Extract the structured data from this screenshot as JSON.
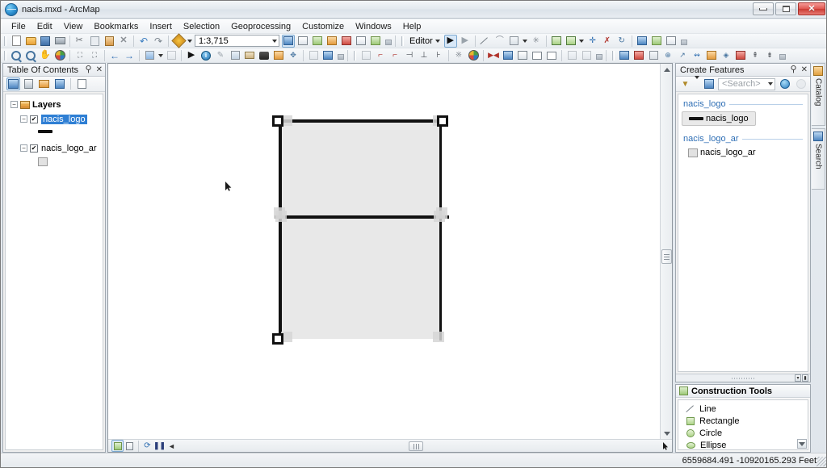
{
  "window": {
    "title": "nacis.mxd - ArcMap",
    "app_icon": "globe-icon",
    "minimize_label": "Minimize",
    "maximize_label": "Maximize",
    "close_label": "✕"
  },
  "menubar": {
    "items": [
      {
        "label": "File"
      },
      {
        "label": "Edit"
      },
      {
        "label": "View"
      },
      {
        "label": "Bookmarks"
      },
      {
        "label": "Insert"
      },
      {
        "label": "Selection"
      },
      {
        "label": "Geoprocessing"
      },
      {
        "label": "Customize"
      },
      {
        "label": "Windows"
      },
      {
        "label": "Help"
      }
    ]
  },
  "standard_toolbar": {
    "scale_value": "1:3,715",
    "scale_dropdown_icon": "chevron-down-icon",
    "buttons": [
      {
        "name": "new-map-document-icon"
      },
      {
        "name": "open-document-icon"
      },
      {
        "name": "save-document-icon"
      },
      {
        "name": "print-icon"
      },
      {
        "name": "cut-icon"
      },
      {
        "name": "copy-icon"
      },
      {
        "name": "paste-icon"
      },
      {
        "name": "delete-icon"
      },
      {
        "name": "undo-icon"
      },
      {
        "name": "redo-icon"
      },
      {
        "name": "add-data-icon"
      }
    ],
    "right_buttons": [
      {
        "name": "editor-toolbar-icon"
      },
      {
        "name": "table-of-contents-icon"
      },
      {
        "name": "catalog-window-icon"
      },
      {
        "name": "search-window-icon"
      },
      {
        "name": "arctoolbox-icon"
      },
      {
        "name": "python-window-icon"
      },
      {
        "name": "model-builder-icon"
      }
    ],
    "editor_label": "Editor"
  },
  "tools_toolbar": {
    "buttons": [
      {
        "name": "zoom-in-icon"
      },
      {
        "name": "zoom-out-icon"
      },
      {
        "name": "pan-icon"
      },
      {
        "name": "full-extent-icon"
      },
      {
        "name": "fixed-zoom-in-icon"
      },
      {
        "name": "fixed-zoom-out-icon"
      },
      {
        "name": "go-back-extent-icon"
      },
      {
        "name": "go-forward-extent-icon"
      },
      {
        "name": "select-features-icon"
      },
      {
        "name": "clear-selection-icon"
      },
      {
        "name": "select-elements-icon"
      },
      {
        "name": "identify-icon"
      },
      {
        "name": "hyperlink-icon"
      },
      {
        "name": "html-popup-icon"
      },
      {
        "name": "measure-icon"
      },
      {
        "name": "find-icon"
      },
      {
        "name": "find-route-icon"
      },
      {
        "name": "go-to-xy-icon"
      },
      {
        "name": "time-slider-icon"
      },
      {
        "name": "create-viewer-window-icon"
      }
    ]
  },
  "table_of_contents": {
    "title": "Table Of Contents",
    "pin_icon": "pin-icon",
    "close_icon": "close-icon",
    "toolbar_buttons": [
      {
        "name": "list-by-drawing-order-icon",
        "selected": true
      },
      {
        "name": "list-by-source-icon",
        "selected": false
      },
      {
        "name": "list-by-visibility-icon",
        "selected": false
      },
      {
        "name": "list-by-selection-icon",
        "selected": false
      },
      {
        "name": "options-icon",
        "selected": false
      }
    ],
    "tree": {
      "root_label": "Layers",
      "root_expander": "−",
      "layers": [
        {
          "label": "nacis_logo",
          "checked": true,
          "check_glyph": "✔",
          "expander": "−",
          "selected": true,
          "symbol": "line-symbol"
        },
        {
          "label": "nacis_logo_ar",
          "checked": true,
          "check_glyph": "✔",
          "expander": "−",
          "selected": false,
          "symbol": "polygon-symbol"
        }
      ]
    }
  },
  "map_view": {
    "data_view_tab_icon": "data-view-icon",
    "layout_view_tab_icon": "layout-view-icon",
    "refresh_icon": "refresh-icon",
    "pause_icon": "pause-drawing-icon",
    "flow_icon": "data-driven-pages-icon",
    "scroll_up_icon": "scroll-up-icon",
    "scroll_down_icon": "scroll-down-icon",
    "cursor": "arrow-cursor",
    "graphic": {
      "description": "selected rectangle feature with edit handles",
      "fill_color": "#e8e8e8",
      "line_color": "#111111",
      "handle_color": "#d6d6d6"
    }
  },
  "create_features": {
    "title": "Create Features",
    "pin_icon": "pin-icon",
    "close_icon": "close-icon",
    "filter_icon": "filter-icon",
    "organize_icon": "organize-templates-icon",
    "search_placeholder": "<Search>",
    "search_value": "",
    "search_dropdown_icon": "chevron-down-icon",
    "search_go_icon": "search-icon",
    "search_clear_icon": "clear-search-icon",
    "groups": [
      {
        "label": "nacis_logo",
        "templates": [
          {
            "label": "nacis_logo",
            "symbol": "line-symbol",
            "selected": true
          }
        ]
      },
      {
        "label": "nacis_logo_ar",
        "templates": [
          {
            "label": "nacis_logo_ar",
            "symbol": "polygon-symbol",
            "selected": false
          }
        ]
      }
    ],
    "splitter_buttons": [
      "▾",
      "▮"
    ]
  },
  "construction_tools": {
    "title": "Construction Tools",
    "header_icon": "construction-tools-icon",
    "items": [
      {
        "label": "Line",
        "icon": "line-tool-icon"
      },
      {
        "label": "Rectangle",
        "icon": "rectangle-tool-icon"
      },
      {
        "label": "Circle",
        "icon": "circle-tool-icon"
      },
      {
        "label": "Ellipse",
        "icon": "ellipse-tool-icon"
      }
    ],
    "scroll_down_icon": "scroll-down-icon"
  },
  "dock_tabs": [
    {
      "label": "Catalog",
      "icon": "catalog-icon"
    },
    {
      "label": "Search",
      "icon": "search-icon"
    }
  ],
  "status_bar": {
    "coordinates": "6559684.491  -10920165.293 Feet"
  }
}
